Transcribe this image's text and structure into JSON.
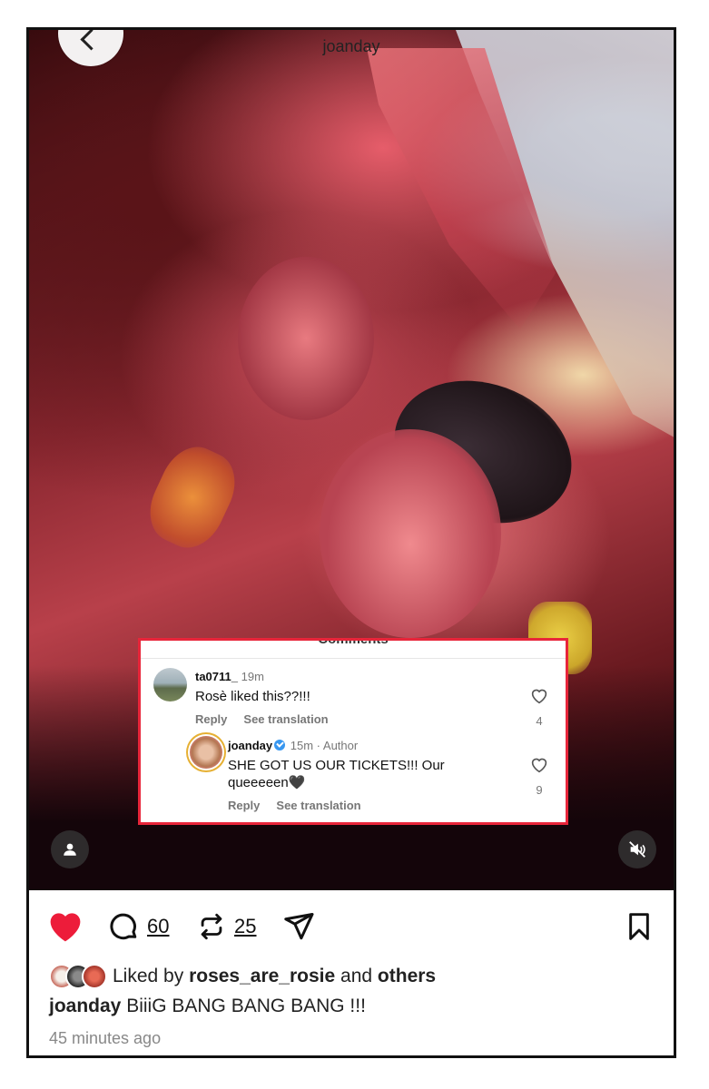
{
  "post": {
    "username": "joanday",
    "caption_user": "joanday",
    "caption_text": "BiiiG BANG BANG BANG !!!",
    "time_ago": "45 minutes ago"
  },
  "comments_panel": {
    "header": "Comments",
    "items": [
      {
        "user": "ta0711_",
        "time": "19m",
        "text": "Rosè liked this??!!!",
        "reply_label": "Reply",
        "translate_label": "See translation",
        "likes": "4"
      },
      {
        "user": "joanday",
        "time": "15m",
        "author_tag": "Author",
        "text_line1": "SHE GOT US OUR TICKETS!!! Our",
        "text_line2": "queeeeen🖤",
        "reply_label": "Reply",
        "translate_label": "See translation",
        "likes": "9"
      }
    ]
  },
  "actions": {
    "comment_count": "60",
    "repost_count": "25",
    "like_color": "#ed1c3a"
  },
  "likes": {
    "prefix": "Liked by",
    "user": "roses_are_rosie",
    "and": "and",
    "others": "others"
  },
  "icons": [
    "back-arrow-icon",
    "profile-icon",
    "mute-icon",
    "heart-icon",
    "comment-icon",
    "repost-icon",
    "share-icon",
    "bookmark-icon",
    "verified-icon"
  ]
}
